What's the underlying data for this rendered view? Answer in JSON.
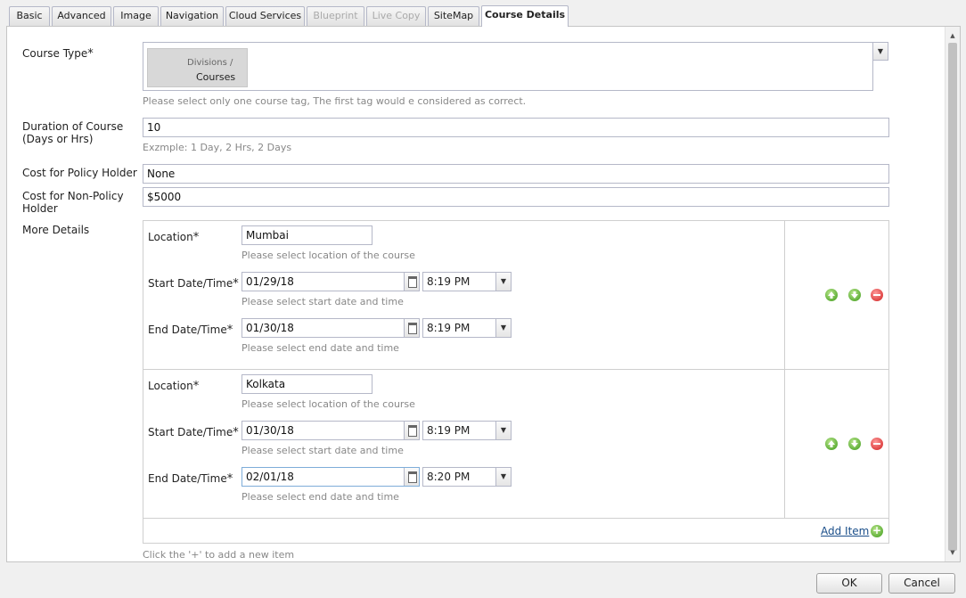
{
  "tabs": [
    {
      "label": "Basic",
      "state": "normal"
    },
    {
      "label": "Advanced",
      "state": "normal"
    },
    {
      "label": "Image",
      "state": "normal"
    },
    {
      "label": "Navigation",
      "state": "normal"
    },
    {
      "label": "Cloud Services",
      "state": "normal"
    },
    {
      "label": "Blueprint",
      "state": "disabled"
    },
    {
      "label": "Live Copy",
      "state": "disabled"
    },
    {
      "label": "SiteMap",
      "state": "normal"
    },
    {
      "label": "Course Details",
      "state": "active"
    }
  ],
  "form": {
    "course_type": {
      "label": "Course Type",
      "required_mark": "*",
      "tag_path": "Divisions /",
      "tag_name": "Courses",
      "hint": "Please select only one course tag, The first tag would e considered as correct."
    },
    "duration": {
      "label": "Duration of Course (Days or Hrs)",
      "value": "10",
      "hint": "Exzmple: 1 Day, 2 Hrs, 2 Days"
    },
    "cost_policy": {
      "label": "Cost for Policy Holder",
      "value": "None"
    },
    "cost_non_policy": {
      "label": "Cost for Non-Policy Holder",
      "value": "$5000"
    },
    "more_details": {
      "label": "More Details",
      "items": [
        {
          "location_label": "Location",
          "location_value": "Mumbai",
          "location_hint": "Please select location of the course",
          "start_label": "Start Date/Time",
          "start_date": "01/29/18",
          "start_time": "8:19 PM",
          "start_hint": "Please select start date and time",
          "end_label": "End Date/Time",
          "end_date": "01/30/18",
          "end_time": "8:19 PM",
          "end_hint": "Please select end date and time"
        },
        {
          "location_label": "Location",
          "location_value": "Kolkata",
          "location_hint": "Please select location of the course",
          "start_label": "Start Date/Time",
          "start_date": "01/30/18",
          "start_time": "8:19 PM",
          "start_hint": "Please select start date and time",
          "end_label": "End Date/Time",
          "end_date": "02/01/18",
          "end_time": "8:20 PM",
          "end_hint": "Please select end date and time"
        }
      ],
      "add_item_label": "Add Item",
      "add_hint": "Click the '+' to add a new item"
    }
  },
  "buttons": {
    "ok": "OK",
    "cancel": "Cancel"
  },
  "icons": {
    "move_up": "arrow-up-icon",
    "move_down": "arrow-down-icon",
    "remove": "remove-icon",
    "add": "add-icon",
    "calendar": "calendar-icon",
    "dropdown": "chevron-down-icon"
  }
}
